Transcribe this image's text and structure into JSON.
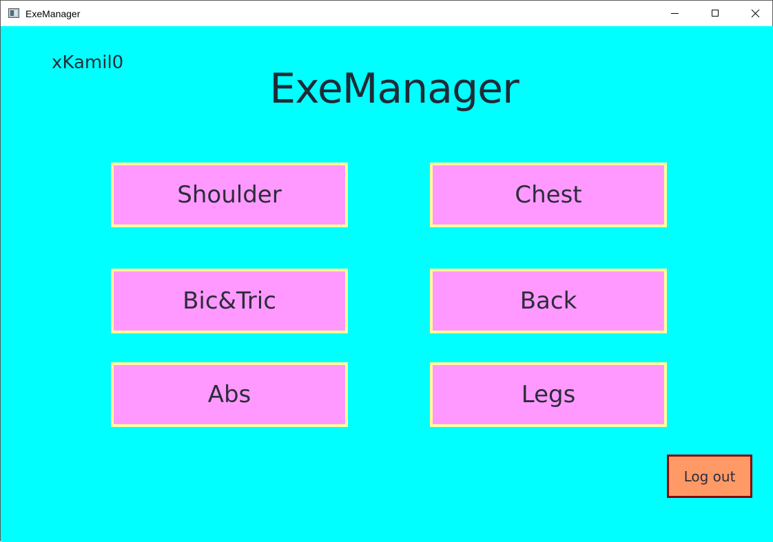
{
  "window": {
    "title": "ExeManager",
    "icon": "app-window-icon",
    "controls": [
      "minimize-icon",
      "maximize-icon",
      "close-icon"
    ]
  },
  "header": {
    "username": "xKamil0",
    "title": "ExeManager"
  },
  "categories": [
    {
      "label": "Shoulder"
    },
    {
      "label": "Chest"
    },
    {
      "label": "Bic&Tric"
    },
    {
      "label": "Back"
    },
    {
      "label": "Abs"
    },
    {
      "label": "Legs"
    }
  ],
  "actions": {
    "logout_label": "Log out"
  },
  "colors": {
    "background": "#00ffff",
    "category_button_fill": "#ff99ff",
    "category_button_border": "#ffff99",
    "logout_button_fill": "#ff9966",
    "logout_button_border": "#8b0000",
    "text": "#2c2c3a"
  }
}
